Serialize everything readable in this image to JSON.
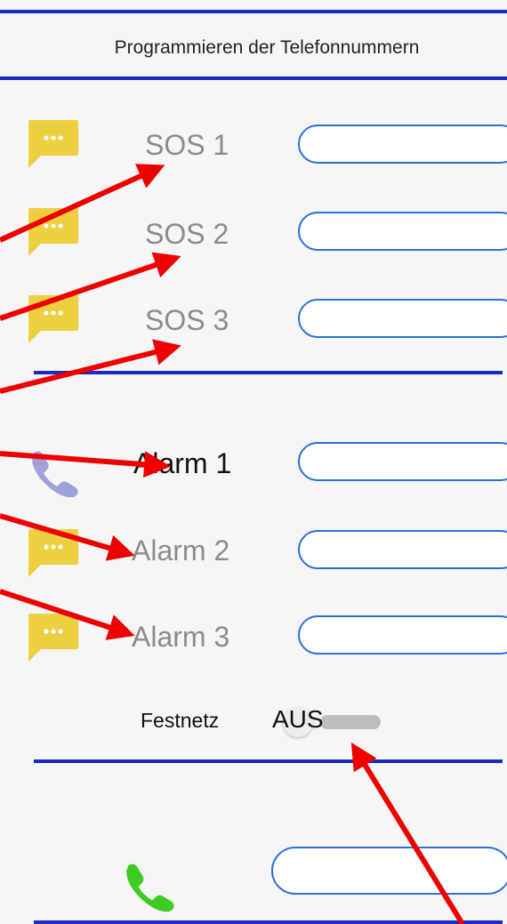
{
  "header": {
    "title": "Programmieren der Telefonnummern"
  },
  "sos": [
    {
      "label": "SOS 1",
      "number": ""
    },
    {
      "label": "SOS 2",
      "number": ""
    },
    {
      "label": "SOS 3",
      "number": ""
    }
  ],
  "alarm": [
    {
      "label": "Alarm 1",
      "number": "",
      "icon": "phone-icon"
    },
    {
      "label": "Alarm 2",
      "number": "",
      "icon": "sms-icon"
    },
    {
      "label": "Alarm 3",
      "number": "",
      "icon": "sms-icon"
    }
  ],
  "landline": {
    "label": "Festnetz",
    "toggle_state": "AUS"
  },
  "bottom": {
    "number": "",
    "icon": "green-phone-icon"
  },
  "colors": {
    "divider": "#1a2bbf",
    "field_border": "#2d6fd8",
    "sms_icon": "#ecd040",
    "phone_icon": "#9fa2d8",
    "green_phone": "#3ccc24",
    "annotation_arrow": "#ee0000"
  }
}
